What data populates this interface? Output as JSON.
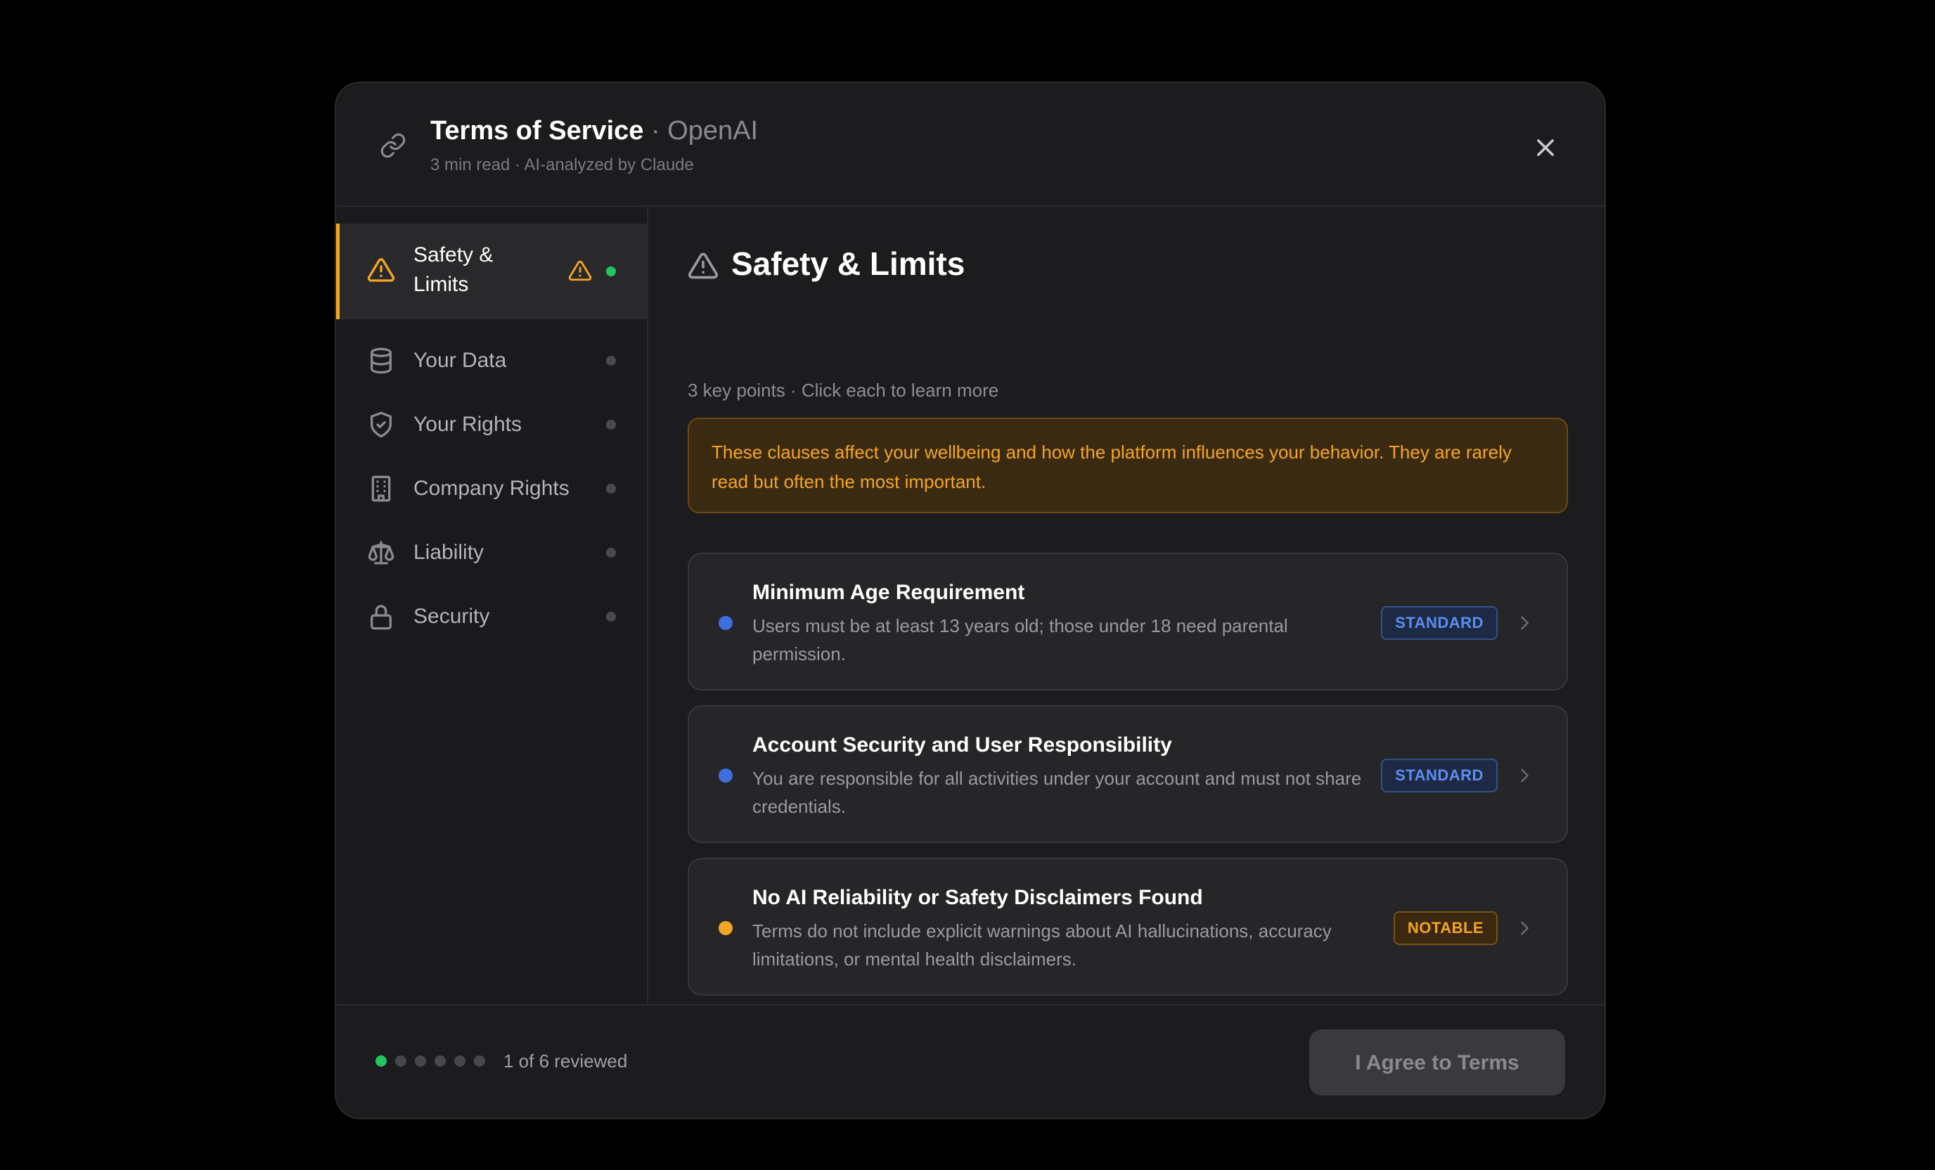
{
  "header": {
    "title": "Terms of Service",
    "separator": "·",
    "company": "OpenAI",
    "subtitle": "3 min read · AI-analyzed by Claude"
  },
  "sidebar": {
    "items": [
      {
        "label": "Safety & Limits",
        "icon": "warning-icon",
        "active": true,
        "status": "reviewed"
      },
      {
        "label": "Your Data",
        "icon": "database-icon"
      },
      {
        "label": "Your Rights",
        "icon": "shield-check-icon"
      },
      {
        "label": "Company Rights",
        "icon": "building-icon"
      },
      {
        "label": "Liability",
        "icon": "scale-icon"
      },
      {
        "label": "Security",
        "icon": "lock-icon"
      }
    ]
  },
  "content": {
    "title": "Safety & Limits",
    "subtitle": "3 key points · Click each to learn more",
    "alert": "These clauses affect your wellbeing and how the platform influences your behavior. They are rarely read but often the most important.",
    "cards": [
      {
        "title": "Minimum Age Requirement",
        "desc": "Users must be at least 13 years old; those under 18 need parental permission.",
        "badge": "STANDARD",
        "dot_color": "#3d6fe0"
      },
      {
        "title": "Account Security and User Responsibility",
        "desc": "You are responsible for all activities under your account and must not share credentials.",
        "badge": "STANDARD",
        "dot_color": "#3d6fe0"
      },
      {
        "title": "No AI Reliability or Safety Disclaimers Found",
        "desc": "Terms do not include explicit warnings about AI hallucinations, accuracy limitations, or mental health disclaimers.",
        "badge": "NOTABLE",
        "dot_color": "#f5a524"
      }
    ]
  },
  "footer": {
    "progress_text": "1 of 6 reviewed",
    "reviewed": 1,
    "total": 6,
    "agree_label": "I Agree to Terms"
  },
  "colors": {
    "accent": "#f5a524",
    "reviewed": "#22c55e",
    "standard": "#5b8ef0"
  }
}
